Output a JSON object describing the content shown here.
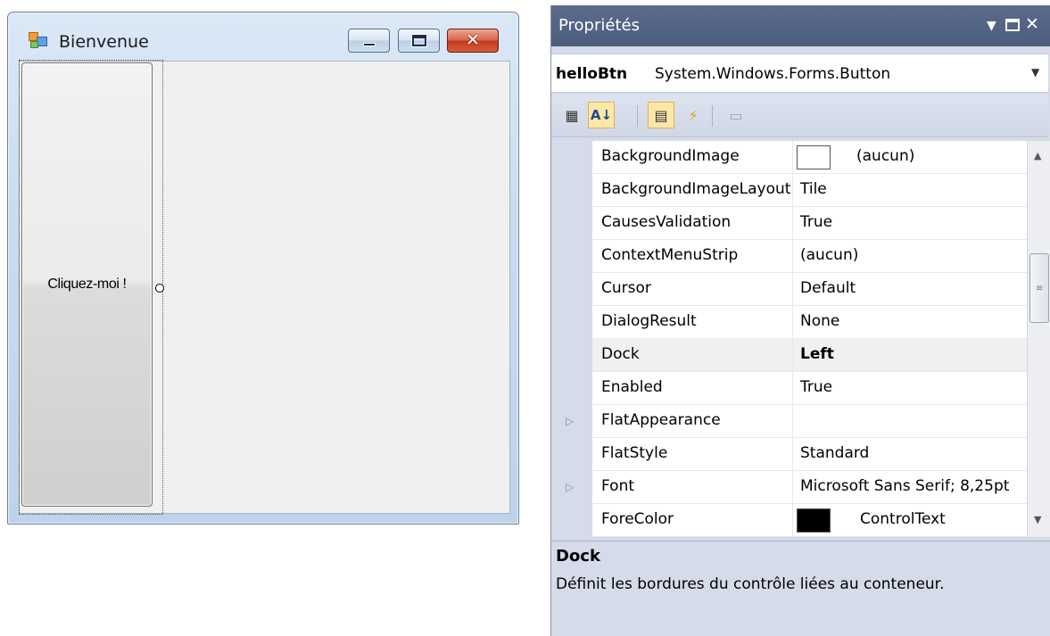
{
  "form": {
    "title": "Bienvenue",
    "icon": "windows-form-icon",
    "button_label": "Cliquez-moi !"
  },
  "properties": {
    "title": "Propriétés",
    "object_name": "helloBtn",
    "object_type": "System.Windows.Forms.Button",
    "toolbar": [
      "categorized-icon",
      "alphabetical-icon",
      "properties-icon",
      "events-icon",
      "property-pages-icon"
    ],
    "rows": [
      {
        "name": "BackgroundImage",
        "value": "(aucun)",
        "swatch": "#ffffff"
      },
      {
        "name": "BackgroundImageLayout",
        "value": "Tile"
      },
      {
        "name": "CausesValidation",
        "value": "True"
      },
      {
        "name": "ContextMenuStrip",
        "value": "(aucun)"
      },
      {
        "name": "Cursor",
        "value": "Default"
      },
      {
        "name": "DialogResult",
        "value": "None"
      },
      {
        "name": "Dock",
        "value": "Left",
        "selected": true
      },
      {
        "name": "Enabled",
        "value": "True"
      },
      {
        "name": "FlatAppearance",
        "value": "",
        "expandable": true
      },
      {
        "name": "FlatStyle",
        "value": "Standard"
      },
      {
        "name": "Font",
        "value": "Microsoft Sans Serif; 8,25pt",
        "expandable": true
      },
      {
        "name": "ForeColor",
        "value": "ControlText",
        "swatch": "#000000"
      }
    ],
    "description": {
      "title": "Dock",
      "text": "Définit les bordures du contrôle liées au conteneur."
    }
  },
  "colors": {
    "panel_title_bg": "#4d5d7e",
    "selected_row_bg": "#f0f0f0",
    "close_button": "#c4391c"
  }
}
